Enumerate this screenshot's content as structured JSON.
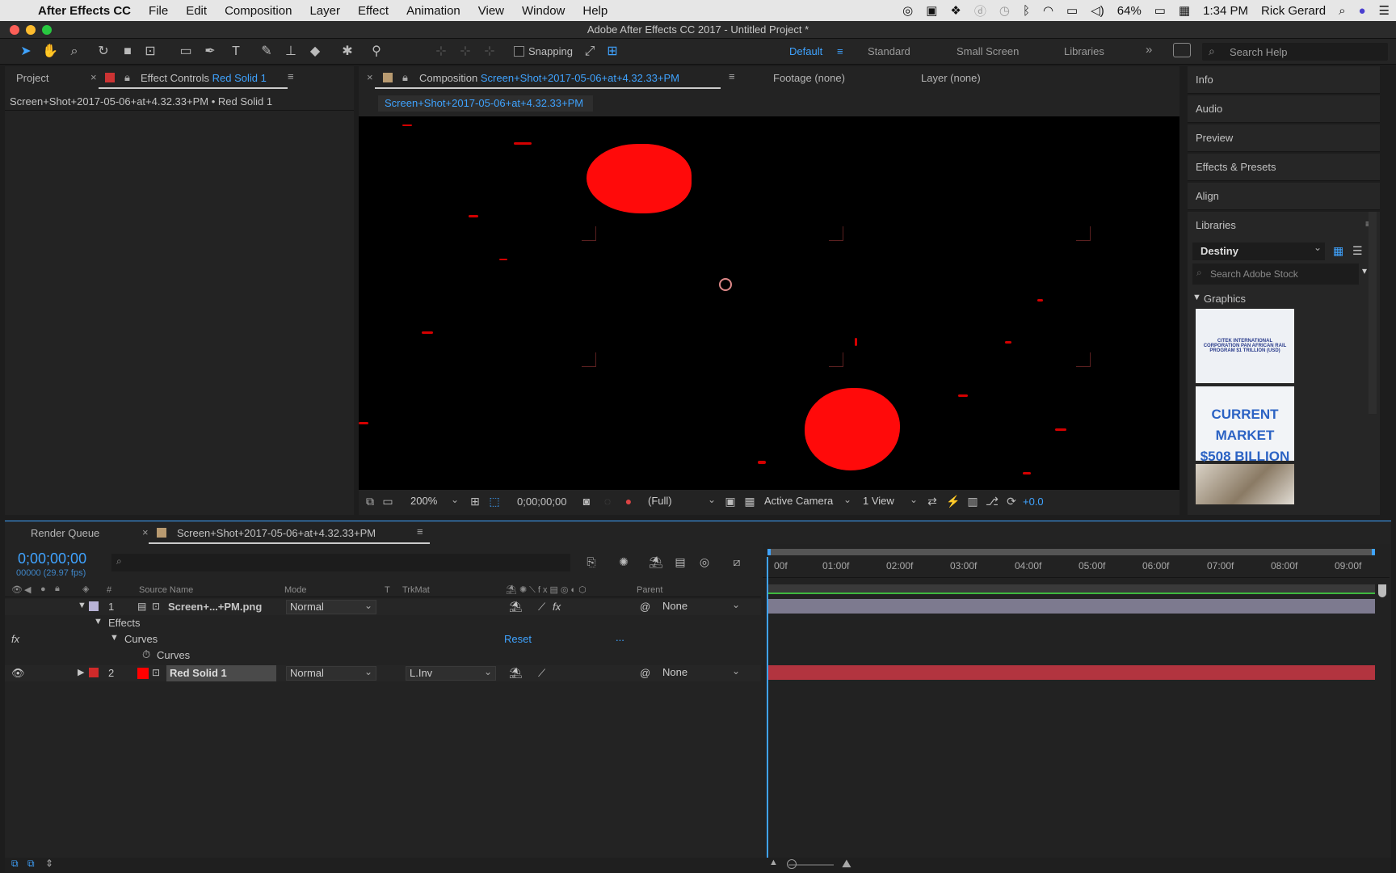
{
  "menubar": {
    "app_name": "After Effects CC",
    "menus": [
      "File",
      "Edit",
      "Composition",
      "Layer",
      "Effect",
      "Animation",
      "View",
      "Window",
      "Help"
    ],
    "battery": "64%",
    "time": "1:34 PM",
    "user": "Rick Gerard"
  },
  "window": {
    "title": "Adobe After Effects CC 2017 - Untitled Project *"
  },
  "toolbar": {
    "snapping_label": "Snapping",
    "workspaces": [
      "Default",
      "Standard",
      "Small Screen",
      "Libraries"
    ],
    "more_glyph": "»",
    "search_help_placeholder": "Search Help"
  },
  "left_panel": {
    "project_tab": "Project",
    "effect_controls_prefix": "Effect Controls",
    "effect_controls_layer": "Red Solid 1",
    "breadcrumb": "Screen+Shot+2017-05-06+at+4.32.33+PM • Red Solid 1"
  },
  "comp_panel": {
    "tab_prefix": "Composition",
    "comp_name": "Screen+Shot+2017-05-06+at+4.32.33+PM",
    "footage_tab": "Footage (none)",
    "layer_tab": "Layer (none)",
    "subtab": "Screen+Shot+2017-05-06+at+4.32.33+PM",
    "zoom": "200%",
    "timecode": "0;00;00;00",
    "resolution": "(Full)",
    "camera": "Active Camera",
    "views": "1 View",
    "exposure": "+0.0"
  },
  "right_panel": {
    "items": [
      "Info",
      "Audio",
      "Preview",
      "Effects & Presets",
      "Align"
    ],
    "libraries_title": "Libraries",
    "library_name": "Destiny",
    "stock_search_placeholder": "Search Adobe Stock",
    "graphics_label": "Graphics",
    "thumb1_text": "CITEK INTERNATIONAL CORPORATION PAN AFRICAN RAIL PROGRAM $1 TRILLION (USD)",
    "thumb2_line1": "CURRENT MARKET",
    "thumb2_line2": "$508 BILLION"
  },
  "timeline": {
    "render_queue_tab": "Render Queue",
    "comp_tab": "Screen+Shot+2017-05-06+at+4.32.33+PM",
    "current_time": "0;00;00;00",
    "frame_info": "00000 (29.97 fps)",
    "columns": {
      "hash": "#",
      "source_name": "Source Name",
      "mode": "Mode",
      "t": "T",
      "trkmat": "TrkMat",
      "parent": "Parent"
    },
    "ruler": [
      "00f",
      "01:00f",
      "02:00f",
      "03:00f",
      "04:00f",
      "05:00f",
      "06:00f",
      "07:00f",
      "08:00f",
      "09:00f"
    ],
    "layers": [
      {
        "num": "1",
        "name": "Screen+...+PM.png",
        "mode": "Normal",
        "trkmat": "",
        "parent": "None",
        "label_color": "#b8b3d6"
      },
      {
        "num": "2",
        "name": "Red Solid 1",
        "mode": "Normal",
        "trkmat": "L.Inv",
        "parent": "None",
        "label_color": "#d02a2a"
      }
    ],
    "effects_label": "Effects",
    "curves_label": "Curves",
    "reset_label": "Reset",
    "more_label": "...",
    "curves_prop": "Curves",
    "fx_label": "fx"
  }
}
